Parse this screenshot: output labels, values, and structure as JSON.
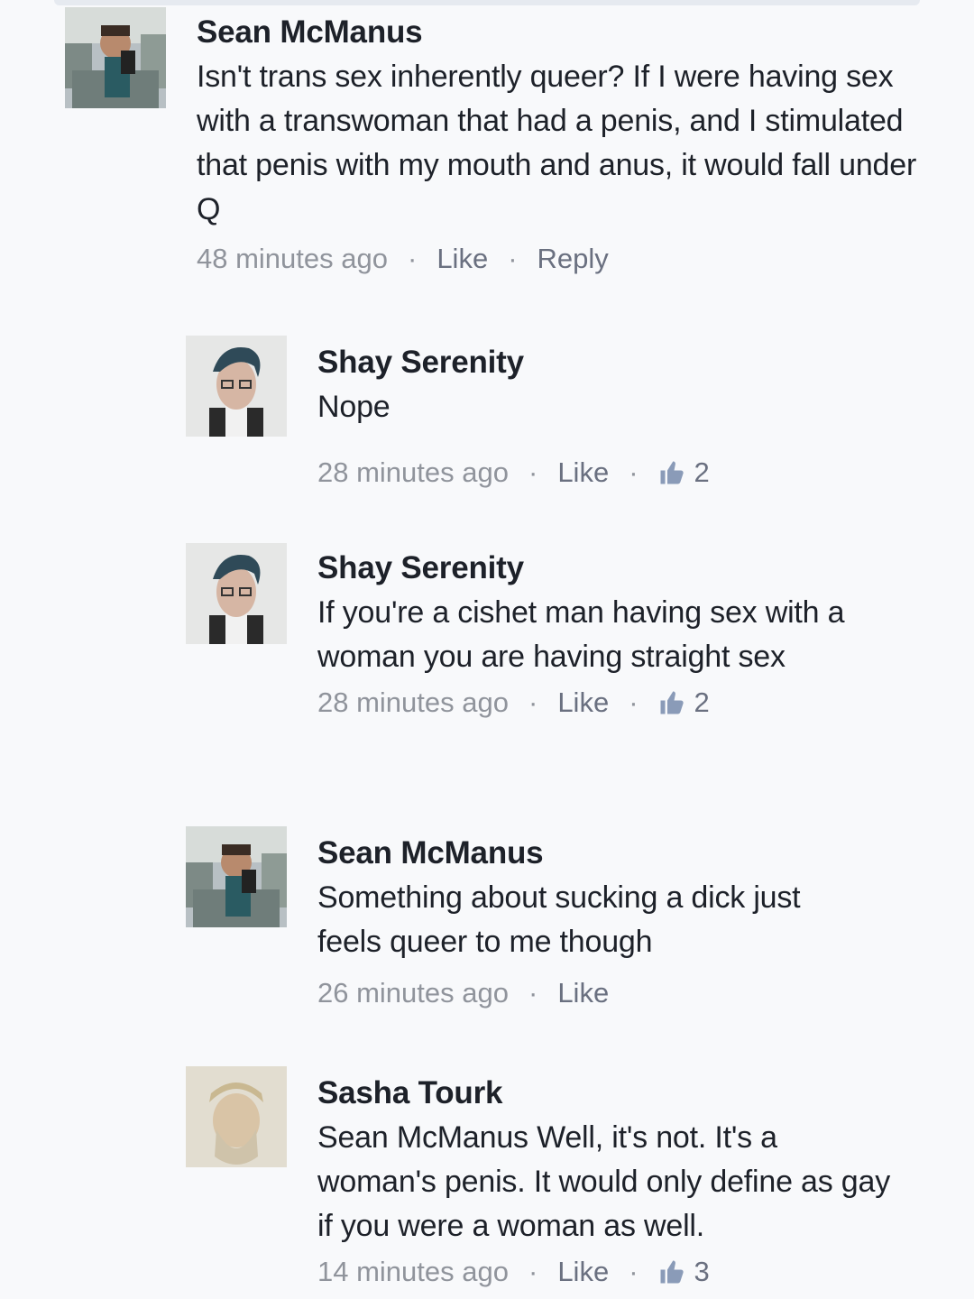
{
  "comments": [
    {
      "author": "Sean McManus",
      "text": "Isn't trans sex inherently queer? If I were having sex with a transwoman that had a penis, and I stimulated that penis with my mouth and anus, it would fall under Q",
      "time": "48 minutes ago",
      "like_label": "Like",
      "reply_label": "Reply",
      "avatar_icon": "profile-photo"
    },
    {
      "author": "Shay Serenity",
      "text": "Nope",
      "time": "28 minutes ago",
      "like_label": "Like",
      "likes_count": "2",
      "avatar_icon": "profile-photo"
    },
    {
      "author": "Shay Serenity",
      "text": "If you're a cishet man having sex with a woman you are having straight sex",
      "time": "28 minutes ago",
      "like_label": "Like",
      "likes_count": "2",
      "avatar_icon": "profile-photo"
    },
    {
      "author": "Sean McManus",
      "text": "Something about sucking a dick just feels queer to me though",
      "time": "26 minutes ago",
      "like_label": "Like",
      "avatar_icon": "profile-photo"
    },
    {
      "author": "Sasha Tourk",
      "text": "Sean McManus Well, it's not. It's a woman's penis. It would only define as gay if you were a woman as well.",
      "time": "14 minutes ago",
      "like_label": "Like",
      "likes_count": "3",
      "avatar_icon": "profile-photo"
    }
  ],
  "separator": "·",
  "colors": {
    "name": "#1d2129",
    "meta": "#90949c",
    "background": "#f8f9fb"
  }
}
